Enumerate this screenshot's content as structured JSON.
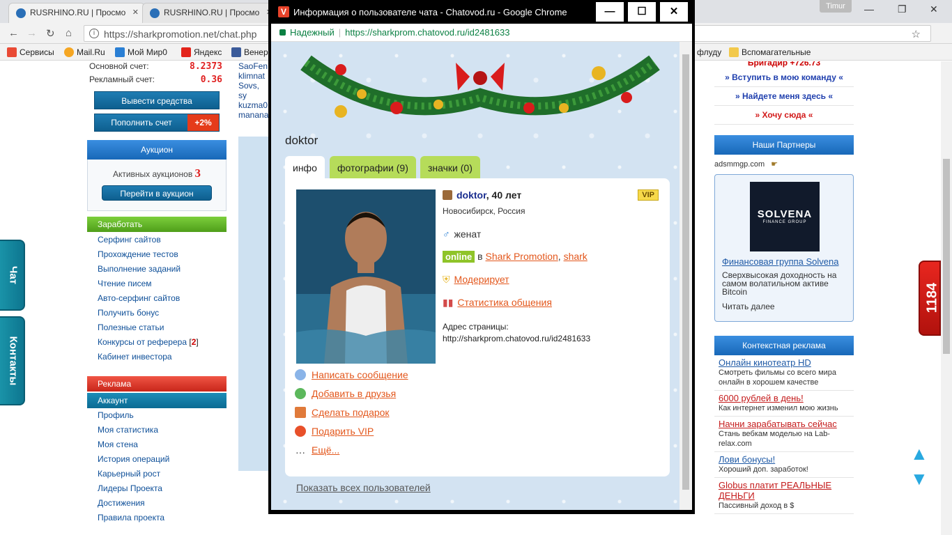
{
  "browser": {
    "tabs": [
      {
        "title": "RUSRHINO.RU | Просмо"
      },
      {
        "title": "RUSRHINO.RU | Просмо"
      }
    ],
    "profile_name": "Timur",
    "address": "https://sharkpromotion.net/chat.php",
    "bookmarks": [
      "Сервисы",
      "Mail.Ru",
      "Мой Мир0",
      "Яндекс",
      "Венер",
      "флуду",
      "Вспомагательные"
    ]
  },
  "left_panel": {
    "main_balance_label": "Основной счет:",
    "main_balance": "8.2373",
    "ad_balance_label": "Рекламный счет:",
    "ad_balance": "0.36",
    "withdraw_button": "Вывести средства",
    "topup_button": "Пополнить счет",
    "topup_bonus": "+2%",
    "auction_header": "Аукцион",
    "active_auctions_label": "Активных аукционов",
    "active_auctions_count": "3",
    "auction_button": "Перейти в аукцион",
    "earn_header": "Заработать",
    "earn_items": [
      "Серфинг сайтов",
      "Прохождение тестов",
      "Выполнение заданий",
      "Чтение писем",
      "Авто-серфинг сайтов",
      "Получить бонус",
      "Полезные статьи",
      "Конкурсы от реферера",
      "Кабинет инвестора"
    ],
    "referrer_badge": "2",
    "ads_header": "Реклама",
    "account_header": "Аккаунт",
    "account_items": [
      "Профиль",
      "Моя статистика",
      "Моя стена",
      "История операций",
      "Карьерный рост",
      "Лидеры Проекта",
      "Достижения",
      "Правила проекта"
    ]
  },
  "middle_fragments": [
    "SaoFen",
    "klimnat",
    "Sovs, sy",
    "kuzma0",
    "manana"
  ],
  "side_tabs": {
    "chat": "Чат",
    "contacts": "Контакты",
    "counter": "1184"
  },
  "right_panel": {
    "top_text": "Бригадир  +726.73",
    "promo_links": [
      "» Вступить в мою команду «",
      "» Найдете меня здесь «",
      "» Хочу сюда «"
    ],
    "partners_header": "Наши Партнеры",
    "partner_site": "adsmmgp.com",
    "partner_logo_text": "SOLVENA",
    "partner_logo_sub": "FINANCE GROUP",
    "partner_title": "Финансовая группа Solvena",
    "partner_desc": "Сверхвысокая доходность на самом волатильном активе Bitcoin",
    "partner_more": "Читать далее",
    "context_header": "Контекстная реклама",
    "ads": [
      {
        "title": "Онлайн кинотеатр HD",
        "desc": "Смотреть фильмы со всего мира онлайн в хорошем качестве"
      },
      {
        "title": "6000 рублей в день!",
        "desc": "Как интернет изменил мою жизнь"
      },
      {
        "title": "Начни зарабатывать сейчас",
        "desc": "Стань вебкам моделью на Lab-relax.com"
      },
      {
        "title": "Лови бонусы!",
        "desc": "Хороший доп. заработок!"
      },
      {
        "title": "Globus платит РЕАЛЬНЫЕ ДЕНЬГИ",
        "desc": "Пассивный доход в $"
      }
    ]
  },
  "popup": {
    "window_title": "Информация о пользователе чата - Chatovod.ru - Google Chrome",
    "secure_label": "Надежный",
    "url": "https://sharkprom.chatovod.ru/id2481633",
    "username": "doktor",
    "tabs": [
      "инфо",
      "фотографии (9)",
      "значки (0)"
    ],
    "name": "doktor",
    "age": ", 40 лет",
    "vip_badge": "VIP",
    "location": "Новосибирск, Россия",
    "marital_status": "женат",
    "online_badge": "online",
    "online_in": "в",
    "room_link": "Shark Promotion",
    "room_sep": ",",
    "room_link2": "shark",
    "moderates": "Модерирует",
    "stats_link": "Статистика общения",
    "page_address_label": "Адрес страницы:",
    "page_address": "http://sharkprom.chatovod.ru/id2481633",
    "actions": [
      "Написать сообщение",
      "Добавить в друзья",
      "Сделать подарок",
      "Подарить VIP",
      "Ещё..."
    ],
    "show_all": "Показать всех пользователей"
  }
}
